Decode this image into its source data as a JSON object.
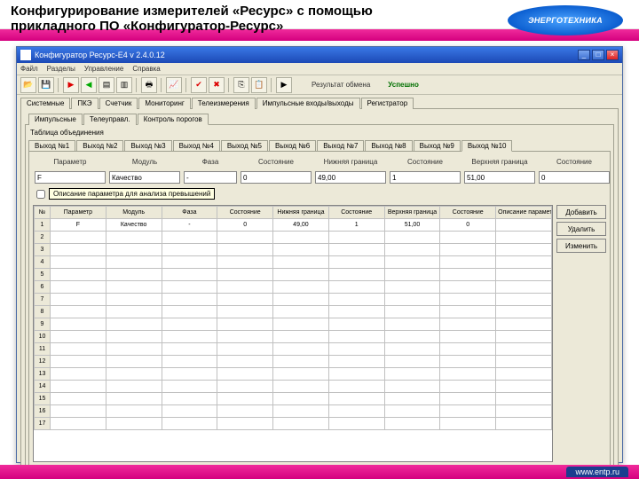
{
  "slide": {
    "title": "Конфигурирование измерителей «Ресурс» с помощью прикладного ПО «Конфигуратор-Ресурс»",
    "logo_text": "ЭНЕРГОТЕХНИКА",
    "url": "www.entp.ru"
  },
  "window": {
    "title": "Конфигуратор Ресурс-E4  v 2.4.0.12",
    "menu": [
      "Файл",
      "Разделы",
      "Управление",
      "Справка"
    ],
    "toolbar_icons": [
      "open",
      "save",
      "sep",
      "flag1",
      "flag2",
      "doc1",
      "doc2",
      "sep",
      "print",
      "sep",
      "chart",
      "sep",
      "ok",
      "cancel",
      "sep",
      "copy",
      "paste",
      "sep",
      "help"
    ],
    "status_label": "Результат обмена",
    "status_value": "Успешно"
  },
  "tabs1": {
    "items": [
      "Системные",
      "ПКЭ",
      "Счетчик",
      "Мониторинг",
      "Телеизмерения",
      "Импульсные входы/выходы",
      "Регистратор"
    ],
    "active": 5
  },
  "tabs2": {
    "items": [
      "Импульсные",
      "Телеуправл.",
      "Контроль порогов"
    ],
    "active": 2
  },
  "tabs3": {
    "items": [
      "Выход №1",
      "Выход №2",
      "Выход №3",
      "Выход №4",
      "Выход №5",
      "Выход №6",
      "Выход №7",
      "Выход №8",
      "Выход №9",
      "Выход №10"
    ],
    "active": 9
  },
  "labels": {
    "separator": "Таблица объединения"
  },
  "fields": {
    "headers": [
      "Параметр",
      "Модуль",
      "Фаза",
      "Состояние",
      "Нижняя граница",
      "Состояние",
      "Верхняя граница",
      "Состояние"
    ],
    "values": [
      "F",
      "Качество",
      "-",
      "0",
      "49,00",
      "1",
      "51,00",
      "0"
    ]
  },
  "checkbox": {
    "label": "Описание параметра для анализа превышений"
  },
  "grid": {
    "headers": [
      "№",
      "Параметр",
      "Модуль",
      "Фаза",
      "Состояние",
      "Нижняя граница",
      "Состояние",
      "Верхняя граница",
      "Состояние",
      "Описание параметра"
    ],
    "row1": [
      "1",
      "F",
      "Качество",
      "-",
      "0",
      "49,00",
      "1",
      "51,00",
      "0",
      ""
    ],
    "rownums": [
      "1",
      "2",
      "3",
      "4",
      "5",
      "6",
      "7",
      "8",
      "9",
      "10",
      "11",
      "12",
      "13",
      "14",
      "15",
      "16",
      "17"
    ]
  },
  "buttons": {
    "add": "Добавить",
    "del": "Удалить",
    "apply": "Изменить"
  }
}
